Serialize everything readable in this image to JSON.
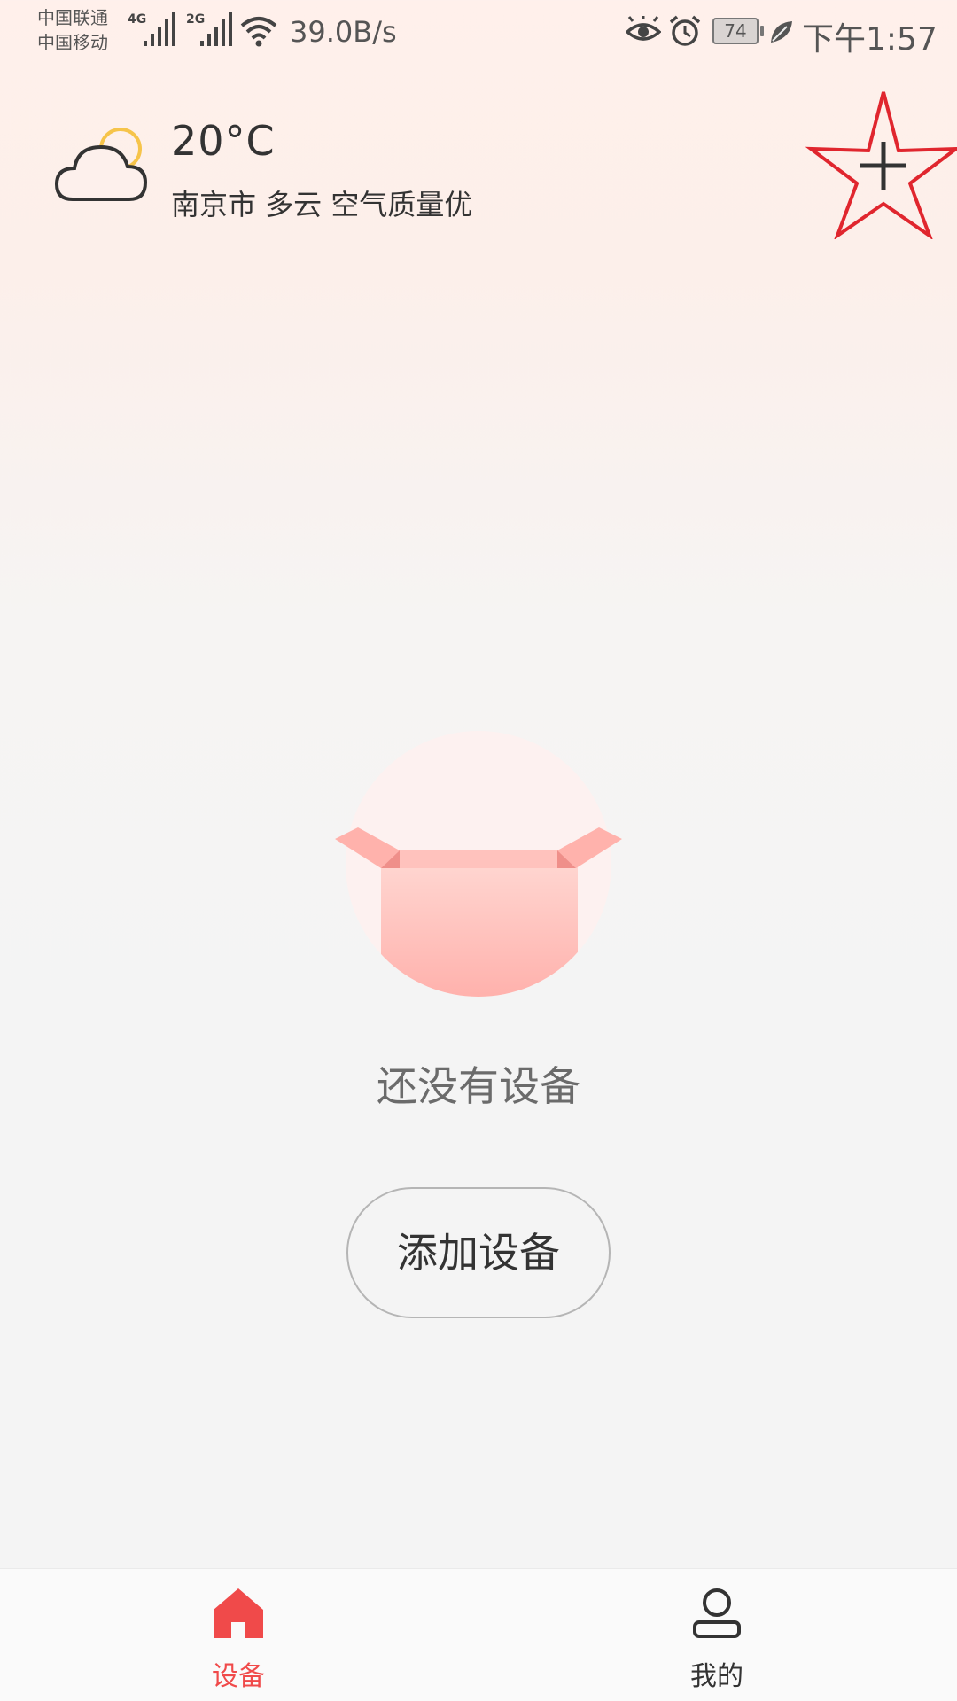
{
  "status_bar": {
    "carrier_1": "中国联通",
    "carrier_2": "中国移动",
    "net_1": "4G",
    "net_2": "2G",
    "net_speed": "39.0B/s",
    "battery": "74",
    "time": "下午1:57",
    "icons": [
      "signal-icon",
      "wifi-icon",
      "eye-icon",
      "alarm-icon",
      "battery-icon",
      "leaf-icon"
    ]
  },
  "weather": {
    "temperature": "20°C",
    "description": "南京市 多云 空气质量优",
    "icon": "cloudy-icon"
  },
  "header": {
    "add_icon": "add-icon",
    "accent_color": "#e0262e"
  },
  "empty_state": {
    "message": "还没有设备",
    "button_label": "添加设备",
    "icon": "empty-box-icon"
  },
  "bottom_nav": {
    "items": [
      {
        "label": "设备",
        "icon": "home-icon",
        "active": true,
        "color": "#f04a4a"
      },
      {
        "label": "我的",
        "icon": "user-icon",
        "active": false,
        "color": "#333333"
      }
    ]
  }
}
